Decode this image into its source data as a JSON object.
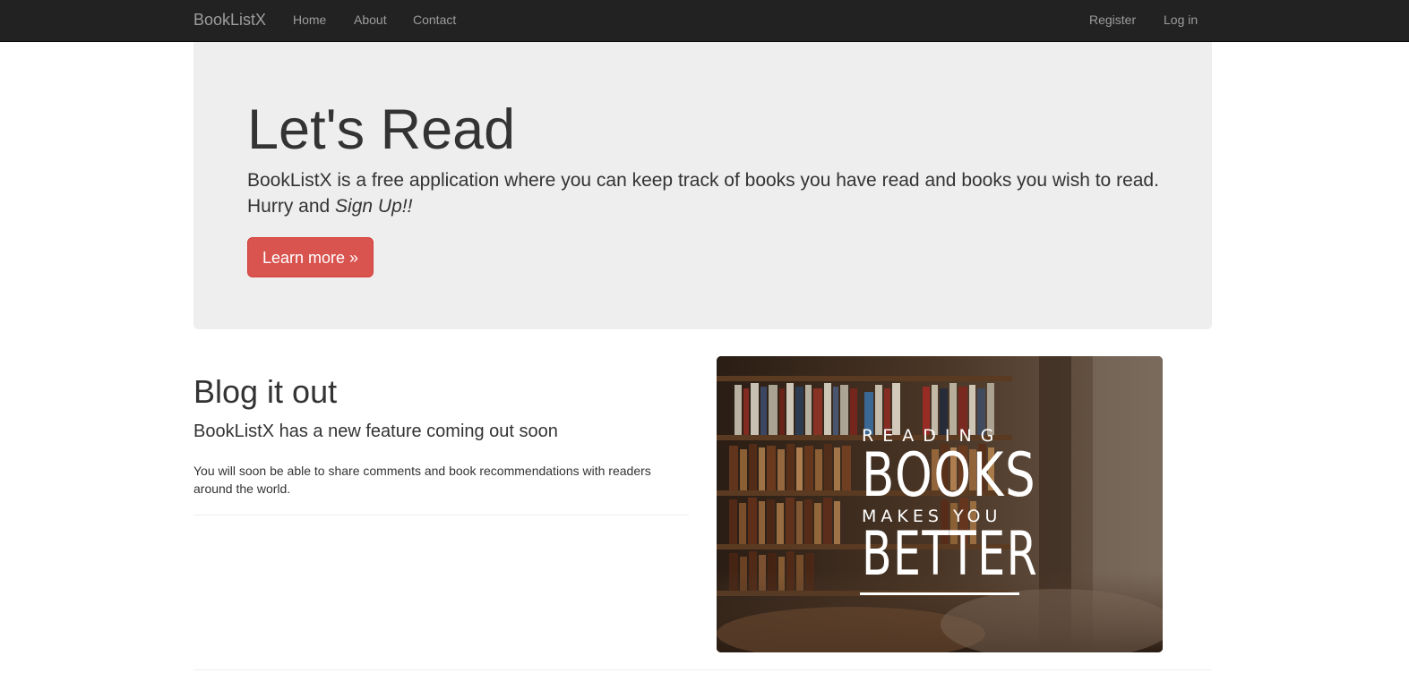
{
  "navbar": {
    "brand": "BookListX",
    "left_links": [
      "Home",
      "About",
      "Contact"
    ],
    "right_links": [
      "Register",
      "Log in"
    ]
  },
  "jumbotron": {
    "title": "Let's Read",
    "text": "BookListX is a free application where you can keep track of books you have read and books you wish to read. Hurry and ",
    "text_emphasis": "Sign Up!!",
    "button_label": "Learn more »"
  },
  "blog": {
    "title": "Blog it out",
    "subtitle": "BookListX has a new feature coming out soon",
    "body": "You will soon be able to share comments and book recommendations with readers around the world."
  },
  "image": {
    "line1": "READING",
    "line2": "BOOKS",
    "line3": "MAKES YOU",
    "line4": "BETTER"
  },
  "colors": {
    "navbar_bg": "#222222",
    "nav_text": "#9d9d9d",
    "jumbotron_bg": "#eeeeee",
    "button_bg": "#d9534f"
  }
}
